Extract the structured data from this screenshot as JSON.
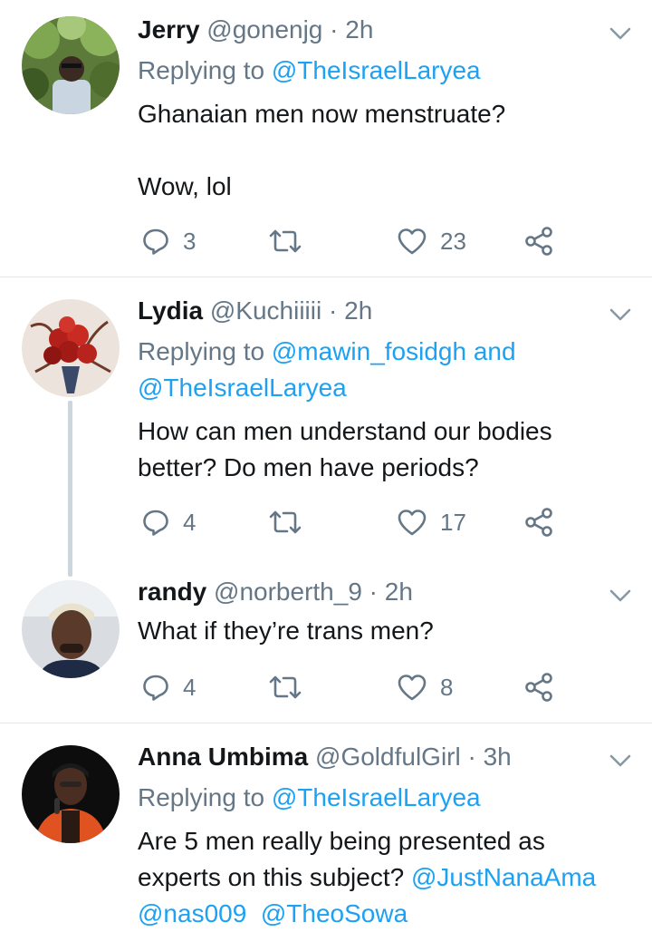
{
  "tweets": [
    {
      "name": "Jerry",
      "handle": "@gonenjg",
      "separator": "·",
      "time": "2h",
      "replying_prefix": "Replying to ",
      "replying_mentions": "@TheIsraelLaryea",
      "replying_mentions_2": "",
      "body_lines": [
        "Ghanaian men now menstruate?",
        "",
        "Wow, lol"
      ],
      "reply_count": "3",
      "retweet_count": "",
      "like_count": "23"
    },
    {
      "name": "Lydia",
      "handle": "@Kuchiiiii",
      "separator": "·",
      "time": "2h",
      "replying_prefix": "Replying to ",
      "replying_mentions": "@mawin_fosidgh and",
      "replying_mentions_2": "@TheIsraelLaryea",
      "body_lines": [
        "How can men understand our bodies",
        "better? Do men have periods?"
      ],
      "reply_count": "4",
      "retweet_count": "",
      "like_count": "17"
    },
    {
      "name": "randy",
      "handle": "@norberth_9",
      "separator": "·",
      "time": "2h",
      "body_lines": [
        "What if they’re trans men?"
      ],
      "reply_count": "4",
      "retweet_count": "",
      "like_count": "8"
    },
    {
      "name": "Anna Umbima",
      "handle": "@GoldfulGirl",
      "separator": "·",
      "time": "3h",
      "replying_prefix": "Replying to ",
      "replying_mentions": "@TheIsraelLaryea",
      "body_lines": [
        "Are 5 men really being presented as"
      ],
      "body_line2_text": "experts on this subject? ",
      "body_line2_mention": "@JustNanaAma",
      "body_line3_mention1": "@nas009",
      "body_line3_mention2": "@TheoSowa"
    }
  ],
  "colors": {
    "link": "#1da1f2",
    "secondary_text": "#657786",
    "primary_text": "#14171a",
    "divider": "#e1e8ed",
    "thread_line": "#ccd6dd"
  },
  "icons": [
    "reply-icon",
    "retweet-icon",
    "like-icon",
    "share-icon",
    "chevron-down-icon"
  ]
}
